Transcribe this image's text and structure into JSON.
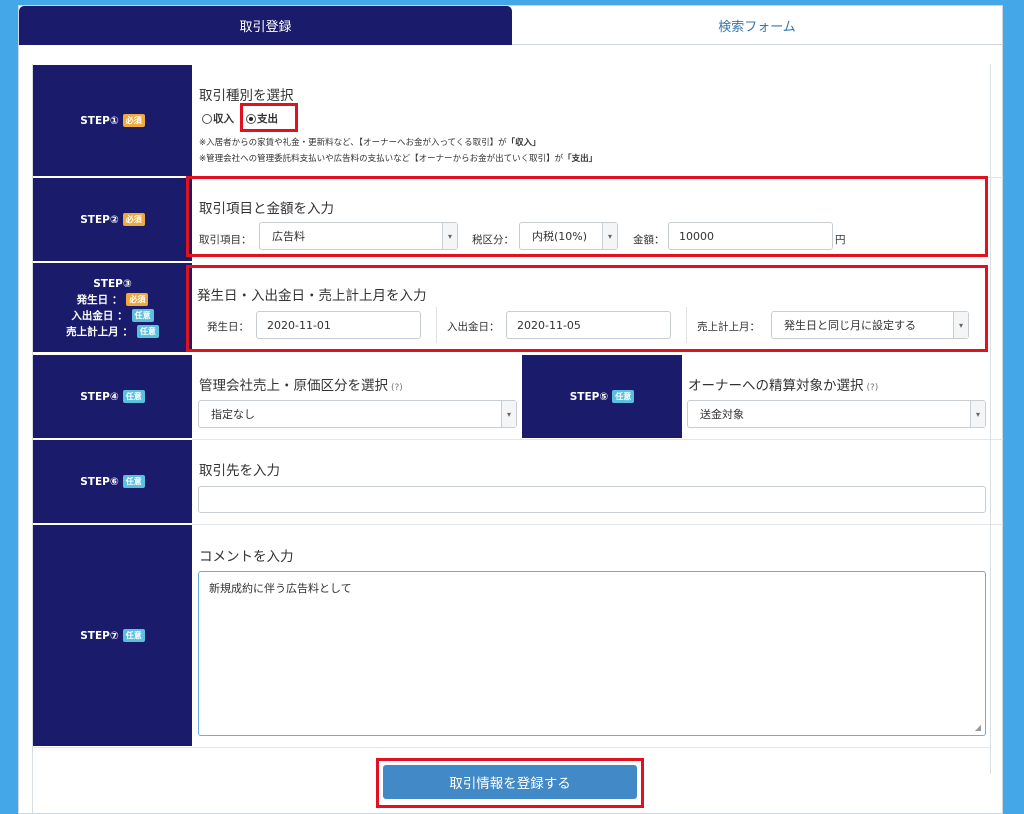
{
  "tabs": {
    "register": "取引登録",
    "search": "検索フォーム"
  },
  "badges": {
    "required": "必須",
    "optional": "任意"
  },
  "steps": {
    "s1": "STEP①",
    "s2": "STEP②",
    "s3": "STEP③",
    "s3_lines": [
      "発生日 ：",
      "入出金日 ：",
      "売上計上月 ："
    ],
    "s4": "STEP④",
    "s5": "STEP⑤",
    "s6": "STEP⑥",
    "s7": "STEP⑦"
  },
  "step1": {
    "heading": "取引種別を選択",
    "options": [
      "収入",
      "支出"
    ],
    "selected": "支出",
    "note1_pre": "※入居者からの家賃や礼金・更新料など、【オーナーへお金が入ってくる取引】が",
    "note1_key": "「収入」",
    "note2_pre": "※管理会社への管理委託料支払いや広告料の支払いなど【オーナーからお金が出ていく取引】が",
    "note2_key": "「支出」"
  },
  "step2": {
    "heading": "取引項目と金額を入力",
    "item_label": "取引項目：",
    "item_value": "広告料",
    "tax_label": "税区分：",
    "tax_value": "内税(10%)",
    "amount_label": "金額：",
    "amount_value": "10000",
    "unit": "円"
  },
  "step3": {
    "heading": "発生日・入出金日・売上計上月を入力",
    "occur_label": "発生日：",
    "occur_value": "2020-11-01",
    "pay_label": "入出金日：",
    "pay_value": "2020-11-05",
    "month_label": "売上計上月：",
    "month_value": "発生日と同じ月に設定する"
  },
  "step4": {
    "heading": "管理会社売上・原価区分を選択",
    "help": "(?)",
    "value": "指定なし"
  },
  "step5": {
    "heading": "オーナーへの精算対象か選択",
    "help": "(?)",
    "value": "送金対象"
  },
  "step6": {
    "heading": "取引先を入力",
    "value": ""
  },
  "step7": {
    "heading": "コメントを入力",
    "value": "新規成約に伴う広告料として"
  },
  "submit": "取引情報を登録する",
  "colors": {
    "navy": "#1a1b6a",
    "accent": "#44a8e8",
    "highlight": "#e2111f",
    "button": "#4189c7"
  }
}
